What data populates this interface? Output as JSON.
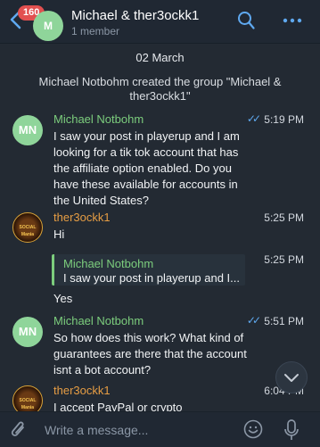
{
  "header": {
    "unread_count": "160",
    "avatar_initials": "M",
    "title": "Michael & ther3ockk1",
    "subtitle": "1 member",
    "back_icon": "chevron-left-icon",
    "search_icon": "search-icon",
    "more_icon": "more-horizontal-icon"
  },
  "chat": {
    "date": "02 March",
    "service_message": "Michael Notbohm created the group \"Michael & ther3ockk1\"",
    "messages": [
      {
        "sender": "Michael Notbohm",
        "avatar": "MN",
        "time": "5:19 PM",
        "read": true,
        "text": "I saw your post in playerup and I am looking for a tik tok account that has the affiliate option enabled.  Do you have these available for accounts in the United States?"
      },
      {
        "sender": "ther3ockk1",
        "avatar": "SOCIAL Mania",
        "time": "5:25 PM",
        "text": "Hi"
      },
      {
        "sender": "",
        "time": "5:25 PM",
        "reply_to": {
          "sender": "Michael Notbohm",
          "text": "I saw your post in playerup and I..."
        },
        "text": "Yes"
      },
      {
        "sender": "Michael Notbohm",
        "avatar": "MN",
        "time": "5:51 PM",
        "read": true,
        "text": "So how does this work?  What kind of guarantees are there that the account isnt a bot account?"
      },
      {
        "sender": "ther3ockk1",
        "avatar": "SOCIAL Mania",
        "time": "6:04 PM",
        "text": "I accept PayPal or crypto"
      }
    ]
  },
  "input": {
    "placeholder": "Write a message..."
  },
  "colors": {
    "background": "#232a33",
    "header": "#202833",
    "accent_green": "#7ccd7d",
    "accent_orange": "#e69d44",
    "badge_red": "#e25050",
    "check_blue": "#5fa9f0"
  }
}
